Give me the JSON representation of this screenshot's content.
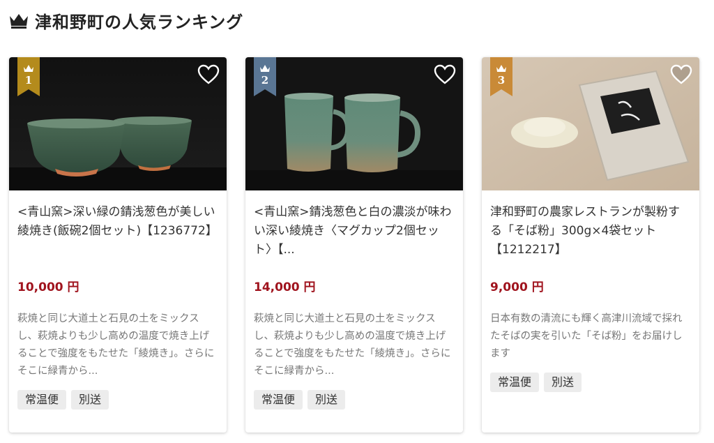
{
  "page": {
    "heading": "津和野町の人気ランキング",
    "heading_icon": "crown-icon"
  },
  "colors": {
    "rank_1": "#b48b1c",
    "rank_2": "#5a7694",
    "rank_3": "#c98a37",
    "price": "#a0141e"
  },
  "products": [
    {
      "rank": "1",
      "title": "<青山窯>深い緑の錆浅葱色が美しい綾焼き(飯碗2個セット)【1236772】",
      "price": "10,000 円",
      "description": "萩焼と同じ大道土と石見の土をミックスし、萩焼よりも少し高めの温度で焼き上げることで強度をもたせた「綾焼き」。さらにそこに緑青から...",
      "tags": [
        "常温便",
        "別送"
      ]
    },
    {
      "rank": "2",
      "title": "<青山窯>錆浅葱色と白の濃淡が味わい深い綾焼き〈マグカップ2個セット〉【...",
      "price": "14,000 円",
      "description": "萩焼と同じ大道土と石見の土をミックスし、萩焼よりも少し高めの温度で焼き上げることで強度をもたせた「綾焼き」。さらにそこに緑青から...",
      "tags": [
        "常温便",
        "別送"
      ]
    },
    {
      "rank": "3",
      "title": "津和野町の農家レストランが製粉する「そば粉」300g×4袋セット【1212217】",
      "price": "9,000 円",
      "description": "日本有数の清流にも輝く高津川流域で採れたそばの実を引いた「そば粉」をお届けします",
      "tags": [
        "常温便",
        "別送"
      ]
    }
  ]
}
